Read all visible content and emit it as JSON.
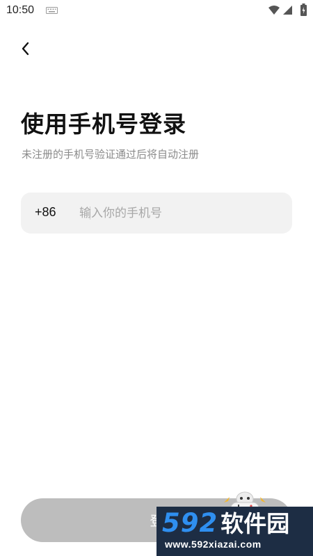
{
  "status_bar": {
    "time": "10:50",
    "icons": [
      "keyboard-icon",
      "wifi-icon",
      "signal-icon",
      "battery-icon"
    ]
  },
  "header": {
    "back_icon": "chevron-left-icon"
  },
  "login": {
    "title": "使用手机号登录",
    "subtitle": "未注册的手机号验证通过后将自动注册",
    "country_code": "+86",
    "phone_placeholder": "输入你的手机号",
    "phone_value": "",
    "button_label": "登"
  },
  "watermark": {
    "brand_digits": "592",
    "brand_name": "软件园",
    "url": "www.592xiazai.com"
  },
  "colors": {
    "background": "#ffffff",
    "input_background": "#f2f2f2",
    "button_disabled": "#bdbdbd",
    "subtitle_text": "#8a8a8a",
    "watermark_bg": "#1d2d44",
    "watermark_accent": "#2f8ff0"
  }
}
